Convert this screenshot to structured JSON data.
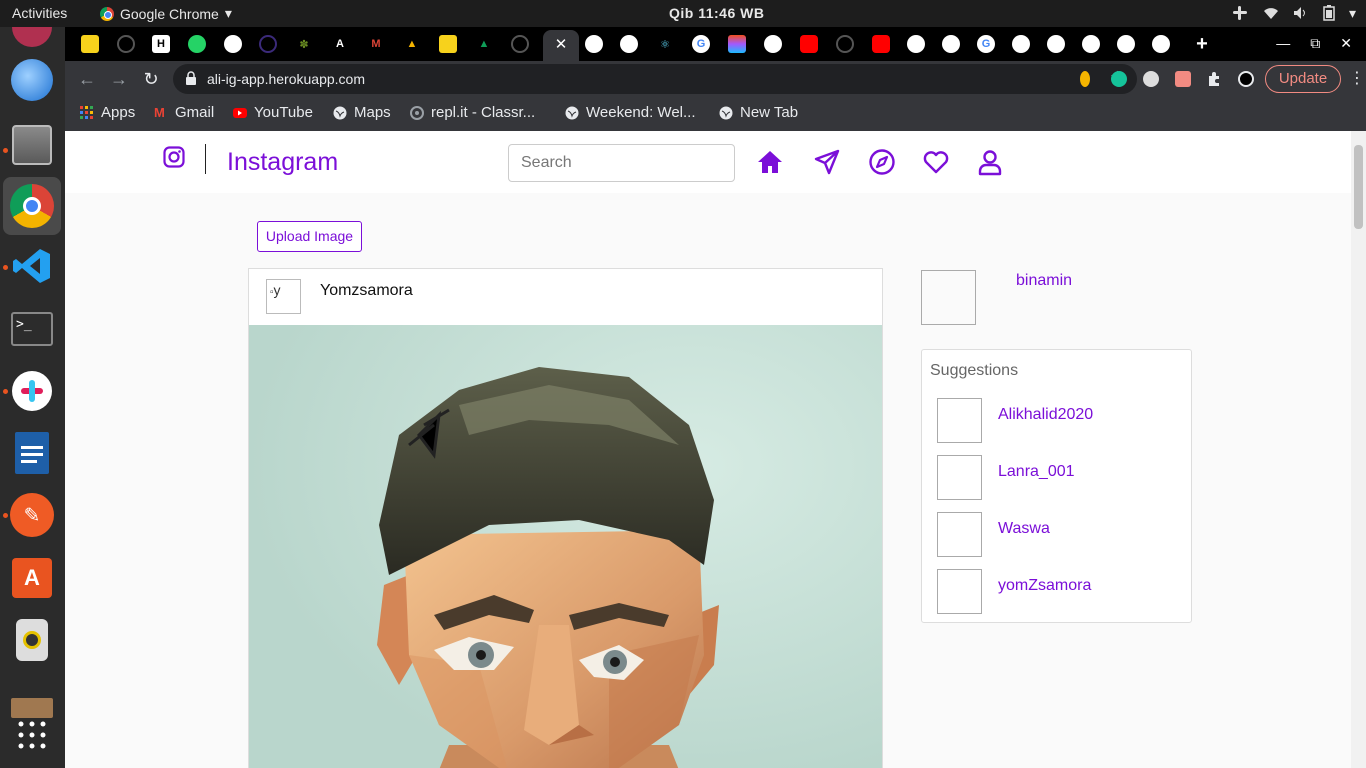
{
  "system_bar": {
    "activities": "Activities",
    "app_name": "Google Chrome",
    "clock": "Qib 11:46 WB"
  },
  "browser": {
    "active_tab_close": "✕",
    "url": "ali-ig-app.herokuapp.com",
    "update_label": "Update",
    "bookmarks": [
      "Apps",
      "Gmail",
      "YouTube",
      "Maps",
      "repl.it - Classr...",
      "Weekend: Wel...",
      "New Tab"
    ]
  },
  "app": {
    "title": "Instagram",
    "search_placeholder": "Search",
    "upload_label": "Upload Image",
    "post": {
      "username": "Yomzsamora",
      "avatar_alt": "y"
    },
    "current_user": "binamin",
    "suggestions_title": "Suggestions",
    "suggestions": [
      "Alikhalid2020",
      "Lanra_001",
      "Waswa",
      "yomZsamora"
    ]
  },
  "colors": {
    "accent": "#7b0fd8",
    "update": "#f28b82"
  }
}
